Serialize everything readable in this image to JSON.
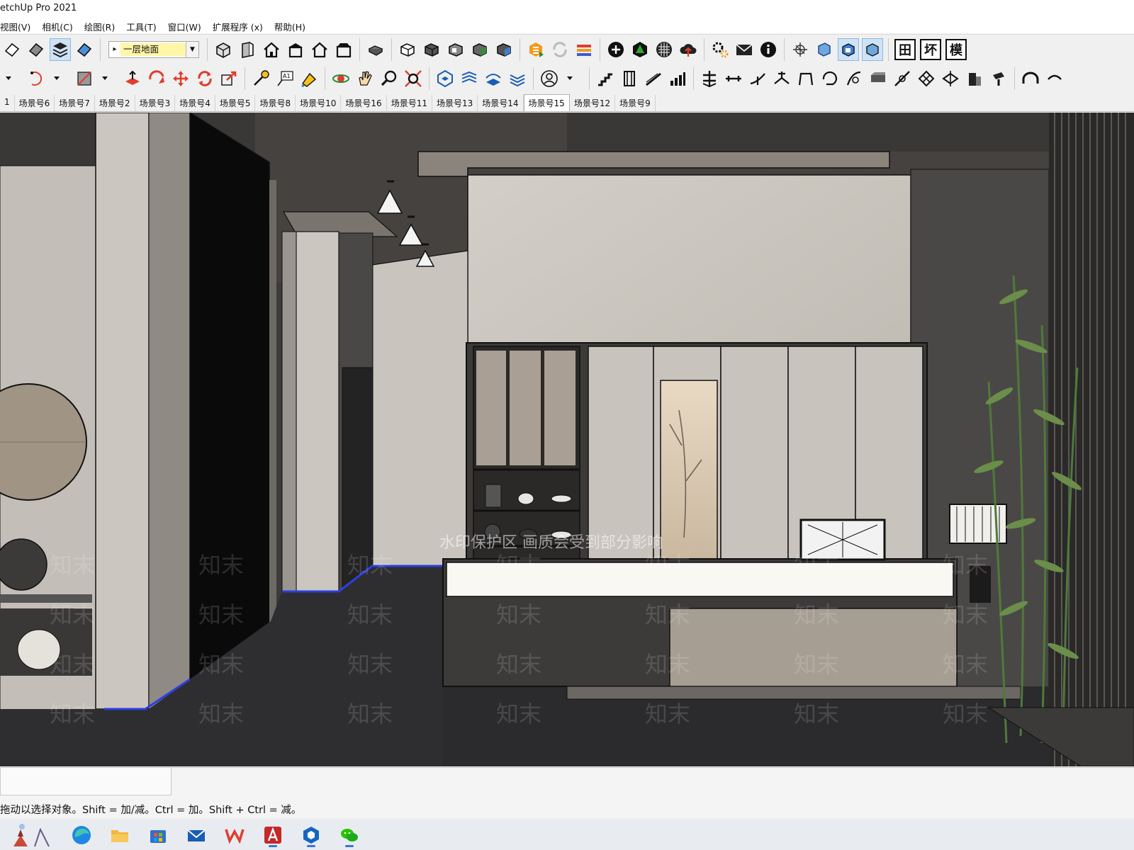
{
  "window": {
    "title": "etchUp Pro 2021"
  },
  "menu": [
    {
      "label": "视图(V)"
    },
    {
      "label": "相机(C)"
    },
    {
      "label": "绘图(R)"
    },
    {
      "label": "工具(T)"
    },
    {
      "label": "窗口(W)"
    },
    {
      "label": "扩展程序 (x)"
    },
    {
      "label": "帮助(H)"
    }
  ],
  "toolbar": {
    "layer_dropdown": {
      "value": "一层地面"
    },
    "text_buttons": [
      "田",
      "坏",
      "模"
    ]
  },
  "scene_tabs": [
    {
      "label": "1"
    },
    {
      "label": "场景号6"
    },
    {
      "label": "场景号7"
    },
    {
      "label": "场景号2"
    },
    {
      "label": "场景号3"
    },
    {
      "label": "场景号4"
    },
    {
      "label": "场景号5"
    },
    {
      "label": "场景号8"
    },
    {
      "label": "场景号10"
    },
    {
      "label": "场景号16"
    },
    {
      "label": "场景号11"
    },
    {
      "label": "场景号13"
    },
    {
      "label": "场景号14"
    },
    {
      "label": "场景号15"
    },
    {
      "label": "场景号12"
    },
    {
      "label": "场景号9"
    }
  ],
  "active_scene_index": 13,
  "viewport": {
    "watermark_notice": "水印保护区  画质会受到部分影响",
    "watermark_text": "知末",
    "colors": {
      "wall_light": "#cfcbc4",
      "wall_dark": "#3e3c3a",
      "floor": "#2b2a2d",
      "counter_white": "#faf8f3",
      "panel_wood": "#a79e93",
      "bamboo": "#5a7d3e",
      "edge_blue": "#2b3fe0"
    }
  },
  "status": {
    "hint": "拖动以选择对象。Shift = 加/减。Ctrl = 加。Shift + Ctrl = 减。"
  },
  "taskbar": {
    "apps": [
      {
        "name": "scenery-widget-icon"
      },
      {
        "name": "edge-browser-icon"
      },
      {
        "name": "file-explorer-icon"
      },
      {
        "name": "store-icon"
      },
      {
        "name": "mail-icon"
      },
      {
        "name": "wps-office-icon"
      },
      {
        "name": "autocad-icon"
      },
      {
        "name": "sketchup-icon"
      },
      {
        "name": "wechat-icon"
      }
    ]
  }
}
